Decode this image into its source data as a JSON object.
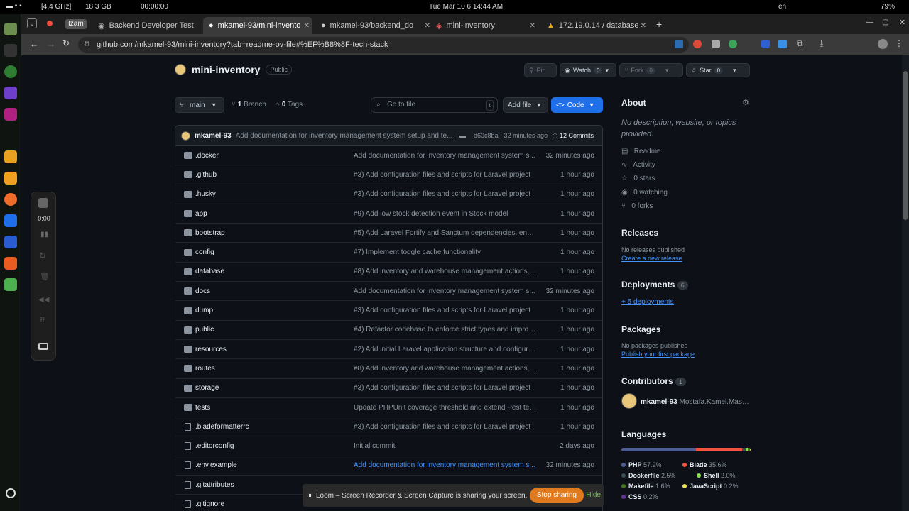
{
  "os_bar": {
    "cpu": "[4.4 GHz]",
    "mem": "18.3 GB",
    "timer": "00:00:00",
    "datetime": "Tue Mar 10   6:14:44 AM",
    "lang": "en",
    "battery": "79%"
  },
  "browser": {
    "profile": "Izam",
    "tabs": [
      {
        "label": "Backend Developer Test"
      },
      {
        "label": "mkamel-93/mini-invento"
      },
      {
        "label": "mkamel-93/backend_do"
      },
      {
        "label": "mini-inventory"
      },
      {
        "label": "172.19.0.14 / database"
      }
    ],
    "url": "github.com/mkamel-93/mini-inventory?tab=readme-ov-file#%EF%B8%8F-tech-stack"
  },
  "repo": {
    "name": "mini-inventory",
    "visibility": "Public",
    "pin": "Pin",
    "watch": "Watch",
    "watch_count": "0",
    "fork": "Fork",
    "fork_count": "0",
    "star": "Star",
    "star_count": "0"
  },
  "toolbar": {
    "branch": "main",
    "branches": "1",
    "branches_label": "Branch",
    "tags": "0",
    "tags_label": "Tags",
    "search_placeholder": "Go to file",
    "search_key": "t",
    "add_file": "Add file",
    "code": "Code"
  },
  "commit": {
    "author": "mkamel-93",
    "message": "Add documentation for inventory management system setup and te...",
    "hash_time": "d60c8ba · 32 minutes ago",
    "commits": "12 Commits"
  },
  "files": [
    {
      "name": ".docker",
      "type": "dir",
      "msg": "Add documentation for inventory management system s...",
      "time": "32 minutes ago"
    },
    {
      "name": ".github",
      "type": "dir",
      "msg": "#3) Add configuration files and scripts for Laravel project",
      "time": "1 hour ago"
    },
    {
      "name": ".husky",
      "type": "dir",
      "msg": "#3) Add configuration files and scripts for Laravel project",
      "time": "1 hour ago"
    },
    {
      "name": "app",
      "type": "dir",
      "msg": "#9) Add low stock detection event in Stock model",
      "time": "1 hour ago"
    },
    {
      "name": "bootstrap",
      "type": "dir",
      "msg": "#5) Add Laravel Fortify and Sanctum dependencies, enha...",
      "time": "1 hour ago"
    },
    {
      "name": "config",
      "type": "dir",
      "msg": "#7) Implement toggle cache functionality",
      "time": "1 hour ago"
    },
    {
      "name": "database",
      "type": "dir",
      "msg": "#8) Add inventory and warehouse management actions, ...",
      "time": "1 hour ago"
    },
    {
      "name": "docs",
      "type": "dir",
      "msg": "Add documentation for inventory management system s...",
      "time": "32 minutes ago"
    },
    {
      "name": "dump",
      "type": "dir",
      "msg": "#3) Add configuration files and scripts for Laravel project",
      "time": "1 hour ago"
    },
    {
      "name": "public",
      "type": "dir",
      "msg": "#4) Refactor codebase to enforce strict types and improv...",
      "time": "1 hour ago"
    },
    {
      "name": "resources",
      "type": "dir",
      "msg": "#2) Add initial Laravel application structure and configura...",
      "time": "1 hour ago"
    },
    {
      "name": "routes",
      "type": "dir",
      "msg": "#8) Add inventory and warehouse management actions, ...",
      "time": "1 hour ago"
    },
    {
      "name": "storage",
      "type": "dir",
      "msg": "#3) Add configuration files and scripts for Laravel project",
      "time": "1 hour ago"
    },
    {
      "name": "tests",
      "type": "dir",
      "msg": "Update PHPUnit coverage threshold and extend Pest test...",
      "time": "1 hour ago"
    },
    {
      "name": ".bladeformatterrc",
      "type": "file",
      "msg": "#3) Add configuration files and scripts for Laravel project",
      "time": "1 hour ago"
    },
    {
      "name": ".editorconfig",
      "type": "file",
      "msg": "Initial commit",
      "time": "2 days ago"
    },
    {
      "name": ".env.example",
      "type": "file",
      "msg": "Add documentation for inventory management system s...",
      "time": "32 minutes ago",
      "link": true
    },
    {
      "name": ".gitattributes",
      "type": "file",
      "msg": "",
      "time": ""
    },
    {
      "name": ".gitignore",
      "type": "file",
      "msg": "",
      "time": ""
    }
  ],
  "about": {
    "title": "About",
    "desc": "No description, website, or topics provided.",
    "readme": "Readme",
    "activity": "Activity",
    "stars": "0 stars",
    "watching": "0 watching",
    "forks": "0 forks"
  },
  "releases": {
    "title": "Releases",
    "none": "No releases published",
    "create": "Create a new release"
  },
  "deployments": {
    "title": "Deployments",
    "count": "6",
    "link": "+ 5 deployments"
  },
  "packages": {
    "title": "Packages",
    "none": "No packages published",
    "publish": "Publish your first package"
  },
  "contributors": {
    "title": "Contributors",
    "count": "1",
    "user": "mkamel-93",
    "full": "Mostafa.Kamel.Maso..."
  },
  "languages": {
    "title": "Languages",
    "items": [
      {
        "name": "PHP",
        "pct": "57.9%",
        "value": 57.9,
        "color": "#4F5D95"
      },
      {
        "name": "Blade",
        "pct": "35.6%",
        "value": 35.6,
        "color": "#f7523f"
      },
      {
        "name": "Dockerfile",
        "pct": "2.5%",
        "value": 2.5,
        "color": "#384d54"
      },
      {
        "name": "Shell",
        "pct": "2.0%",
        "value": 2.0,
        "color": "#89e051"
      },
      {
        "name": "Makefile",
        "pct": "1.6%",
        "value": 1.6,
        "color": "#427819"
      },
      {
        "name": "JavaScript",
        "pct": "0.2%",
        "value": 0.2,
        "color": "#f1e05a"
      },
      {
        "name": "CSS",
        "pct": "0.2%",
        "value": 0.2,
        "color": "#663399"
      }
    ]
  },
  "recorder": {
    "time": "0:00"
  },
  "toast": {
    "text": "Loom – Screen Recorder & Screen Capture is sharing your screen.",
    "stop": "Stop sharing",
    "hide": "Hide"
  }
}
